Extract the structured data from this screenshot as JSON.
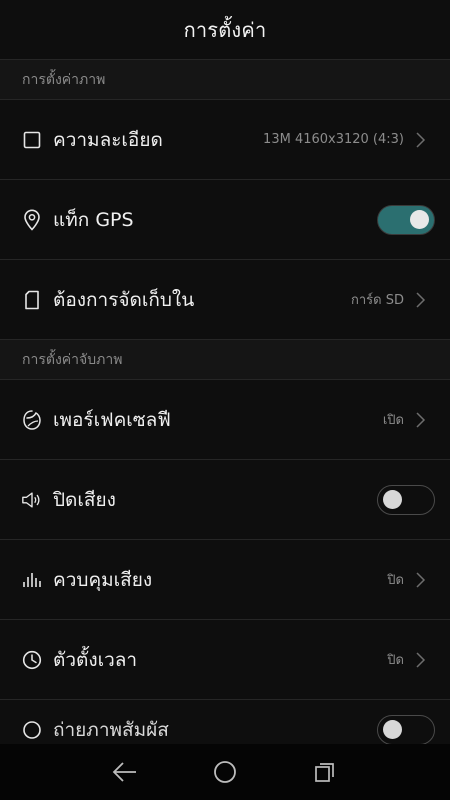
{
  "header": {
    "title": "การตั้งค่า"
  },
  "sections": [
    {
      "title": "การตั้งค่าภาพ"
    },
    {
      "title": "การตั้งค่าจับภาพ"
    }
  ],
  "rows": {
    "resolution": {
      "label": "ความละเอียด",
      "value": "13M 4160x3120 (4:3)",
      "icon": "square-icon"
    },
    "gps": {
      "label": "แท็ก GPS",
      "toggle": true,
      "icon": "location-pin-icon"
    },
    "storage": {
      "label": "ต้องการจัดเก็บใน",
      "value": "การ์ด SD",
      "icon": "file-icon"
    },
    "selfie": {
      "label": "เพอร์เฟคเซลฟี",
      "value": "เปิด",
      "icon": "selfie-face-icon"
    },
    "mute": {
      "label": "ปิดเสียง",
      "toggle": false,
      "icon": "speaker-icon"
    },
    "audio_control": {
      "label": "ควบคุมเสียง",
      "value": "ปิด",
      "icon": "audio-levels-icon"
    },
    "timer": {
      "label": "ตัวตั้งเวลา",
      "value": "ปิด",
      "icon": "clock-icon"
    },
    "touch_capture": {
      "label": "ถ่ายภาพสัมผัส",
      "toggle": false,
      "icon": "touch-icon"
    }
  },
  "navbar": {
    "back": "back-icon",
    "home": "home-icon",
    "recents": "recents-icon"
  },
  "colors": {
    "accent": "#2b6f70",
    "background": "#0e0e0e",
    "divider": "#262626"
  }
}
